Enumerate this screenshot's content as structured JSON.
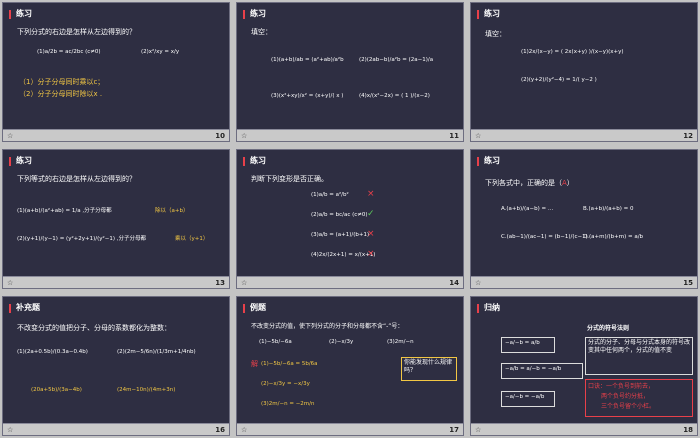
{
  "slides": [
    {
      "num": "10",
      "title": "练习",
      "q": "下列分式的右边是怎样从左边得到的？",
      "f1": "(1)a/2b = ac/2bc (c≠0)",
      "f2": "(2)x²/xy = x/y",
      "a1": "（1）分子分母同时乘以c；",
      "a2": "（2）分子分母同时除以x ."
    },
    {
      "num": "11",
      "title": "练习",
      "q": "填空：",
      "f1": "(1)(a+b)/ab = (a²+ab)/a²b",
      "f2": "(2)(2ab−b)/a²b = (2a−1)/a",
      "f3": "(3)(x²+xy)/x² = (x+y)/( x )",
      "f4": "(4)x/(x²−2x) = ( 1 )/(x−2)"
    },
    {
      "num": "12",
      "title": "练习",
      "q": "填空：",
      "f1": "(1)2x/(x−y) = ( 2x(x+y) )/(x−y)(x+y)",
      "f2": "(2)(y+2)/(y²−4) = 1/( y−2 )"
    },
    {
      "num": "13",
      "title": "练习",
      "q": "下列等式的右边是怎样从左边得到的？",
      "f1": "(1)(a+b)/(a²+ab) = 1/a ,分子分母都",
      "a1": "除以（a+b）",
      "f2": "(2)(y+1)/(y−1) = (y²+2y+1)/(y²−1) ,分子分母都",
      "a2": "乘以（y+1）"
    },
    {
      "num": "14",
      "title": "练习",
      "q": "判断下列变形是否正确。",
      "f1": "(1)a/b = a²/b²",
      "f2": "(2)a/b = bc/ac (c≠0)",
      "f3": "(3)a/b = (a+1)/(b+1)",
      "f4": "(4)2x/(2x+1) = x/(x+1)",
      "m1": "×",
      "m2": "✓",
      "m3": "×",
      "m4": "×"
    },
    {
      "num": "15",
      "title": "练习",
      "q": "下列各式中，正确的是（",
      "ans": "A",
      "qend": "）",
      "A": "A.(a+b)/(a−b) = …",
      "B": "B.(a+b)/(a+b) = 0",
      "C": "C.(ab−1)/(ac−1) = (b−1)/(c−1)",
      "D": "D.(a+m)/(b+m) = a/b"
    },
    {
      "num": "16",
      "title": "补充题",
      "q": "不改变分式的值把分子、分母的系数都化为整数：",
      "f1": "(1)(2a+0.5b)/(0.3a−0.4b)",
      "f2": "(2)(2m−5/6n)/(1/3m+1/4nb)",
      "a1": "(20a+5b)/(3a−4b)",
      "a2": "(24m−10n)/(4m+3n)"
    },
    {
      "num": "17",
      "title": "例题",
      "q": "不改变分式的值，使下列分式的分子和分母都不含“-”号：",
      "f1": "(1)−5b/−6a",
      "f2": "(2)−x/3y",
      "f3": "(3)2m/−n",
      "sol": "解",
      "s1": "(1)−5b/−6a = 5b/6a",
      "s2": "(2)−x/3y = −x/3y",
      "s3": "(3)2m/−n = −2m/n",
      "note": "你能发现什么规律吗？"
    },
    {
      "num": "18",
      "title": "归纳",
      "heading": "分式的符号法则",
      "rule": "分式的分子、分母与分式本身的符号改变其中任何两个，分式的值不变",
      "tip1": "口诀：一个负号到前去，",
      "tip2": "两个负号约分抵，",
      "tip3": "三个负号留个小杠。",
      "e1": "−a/−b = a/b",
      "e2": "−a/b = a/−b = −a/b",
      "e3": "−a/−b = −a/b"
    }
  ],
  "colors": {
    "slide_bg": "#2e2e42",
    "accent": "#f2c744",
    "marker": "#e8404a",
    "footer": "#c9c9c9"
  }
}
